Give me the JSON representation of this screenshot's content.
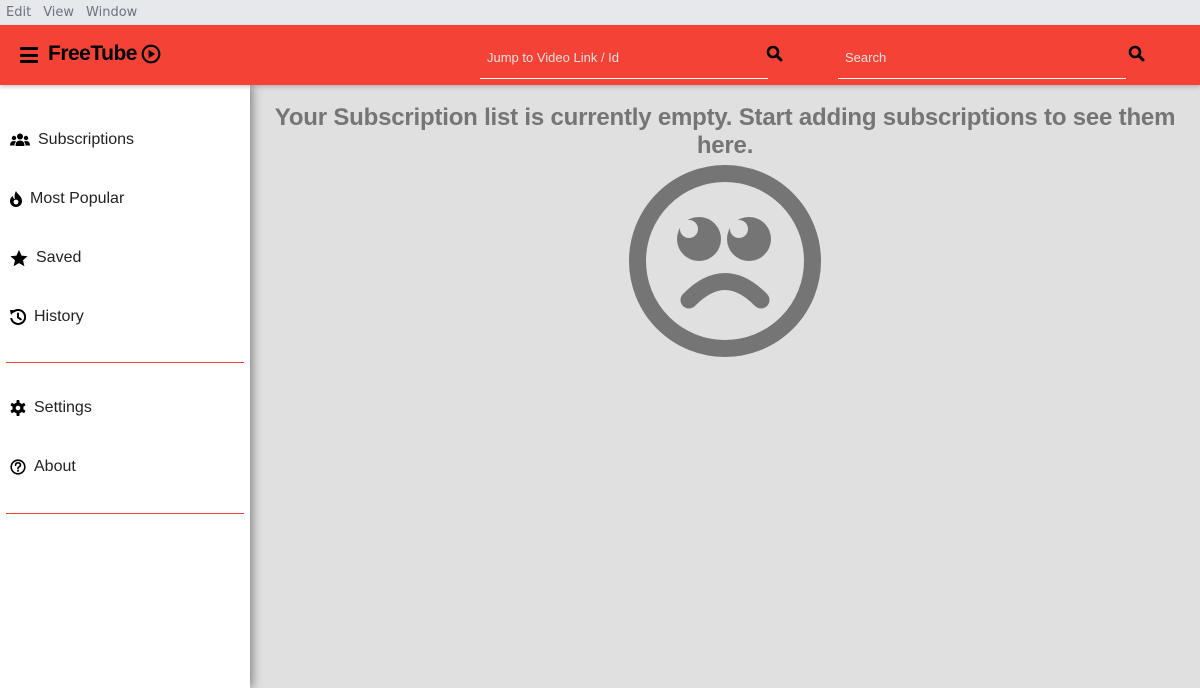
{
  "menubar": {
    "items": [
      "Edit",
      "View",
      "Window"
    ]
  },
  "header": {
    "app_name": "FreeTube",
    "jump_input": {
      "placeholder": "Jump to Video Link / Id",
      "value": ""
    },
    "search_input": {
      "placeholder": "Search",
      "value": ""
    },
    "accent_color": "#f44336"
  },
  "sidebar": {
    "items": [
      {
        "label": "Subscriptions",
        "icon": "users-icon"
      },
      {
        "label": "Most Popular",
        "icon": "fire-icon"
      },
      {
        "label": "Saved",
        "icon": "star-icon"
      },
      {
        "label": "History",
        "icon": "history-icon"
      },
      {
        "label": "Settings",
        "icon": "gear-icon"
      },
      {
        "label": "About",
        "icon": "question-circle-icon"
      }
    ]
  },
  "main": {
    "empty_message": "Your Subscription list is currently empty. Start adding subscriptions to see them here.",
    "empty_icon": "sad-face-icon"
  }
}
